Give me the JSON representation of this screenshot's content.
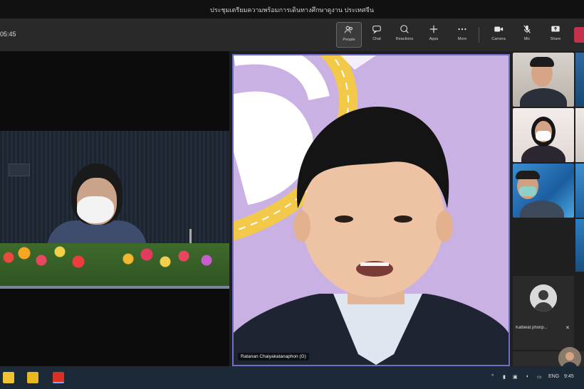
{
  "window": {
    "title": "ประชุมเตรียมความพร้อมการเดินทางศึกษาดูงาน ประเทศจีน"
  },
  "toolbar": {
    "timer": "05:45",
    "buttons": [
      {
        "id": "people",
        "label": "People",
        "icon": "people-icon"
      },
      {
        "id": "chat",
        "label": "Chat",
        "icon": "chat-icon"
      },
      {
        "id": "reactions",
        "label": "Reactions",
        "icon": "reactions-icon"
      },
      {
        "id": "apps",
        "label": "Apps",
        "icon": "plus-icon"
      },
      {
        "id": "more",
        "label": "More",
        "icon": "more-icon"
      },
      {
        "id": "camera",
        "label": "Camera",
        "icon": "camera-icon"
      },
      {
        "id": "mic",
        "label": "Mic",
        "icon": "mic-icon"
      },
      {
        "id": "share",
        "label": "Share",
        "icon": "share-icon"
      }
    ]
  },
  "stage": {
    "center_participant_name": "Ratanan Chaiyakatanaphon (G)",
    "avatar_participant_name": "Kattiwat phonp...",
    "colors": {
      "active_border": "#6d6fc4",
      "background_lilac": "#c9b1e3",
      "road_yellow": "#f3c94a"
    }
  },
  "taskbar": {
    "tray_lang": "ENG",
    "tray_time": "9:45"
  }
}
